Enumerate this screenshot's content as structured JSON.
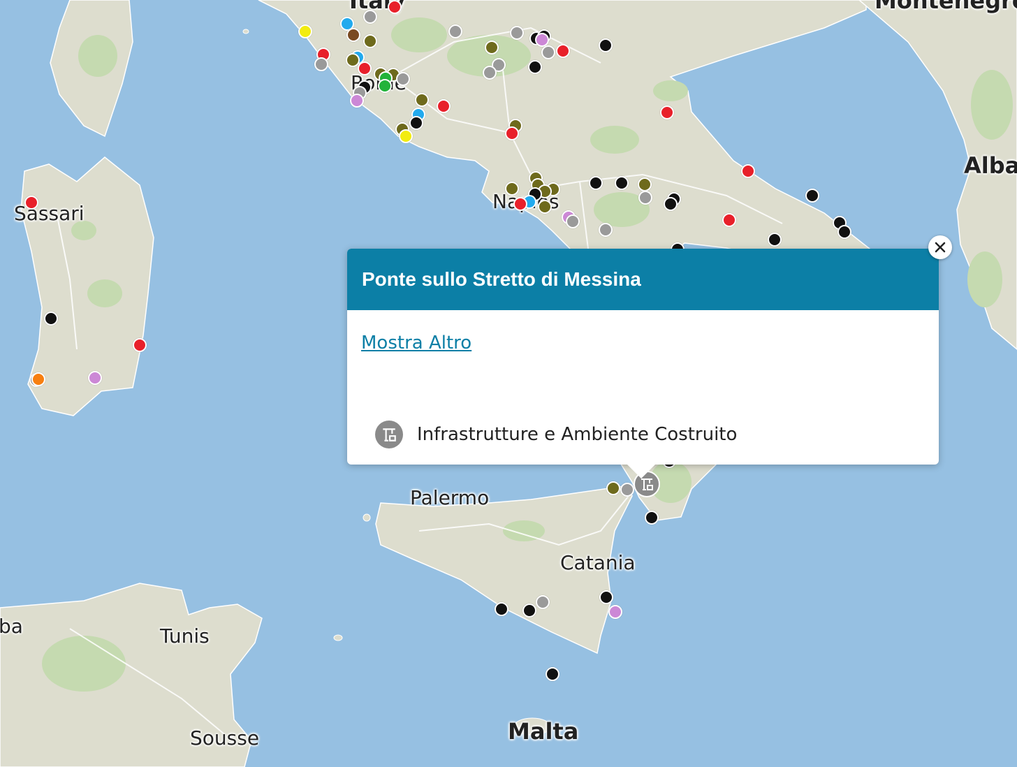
{
  "map": {
    "place_labels": {
      "italy": "Italy",
      "rome": "Rome",
      "naples": "Naples",
      "sassari": "Sassari",
      "palermo": "Palermo",
      "catania": "Catania",
      "tunis": "Tunis",
      "sousse": "Sousse",
      "malta": "Malta",
      "albania": "Alba",
      "montenegro": "Montenegro",
      "algeria_partial": "ba"
    },
    "marker_colors": {
      "black": "#111111",
      "red": "#e8202a",
      "grey": "#9a9a9a",
      "olive": "#6e6a1c",
      "yellow": "#f2ec10",
      "cyan": "#22aaee",
      "green": "#22b33a",
      "brown": "#7a4a22",
      "violet": "#cc88d6",
      "orange": "#f77f10"
    },
    "colors": {
      "sea": "#96c0e2",
      "land": "#ddddce",
      "forest": "#c5dab0",
      "popup_header": "#0c7fa6"
    }
  },
  "popup": {
    "title": "Ponte sullo Stretto di Messina",
    "link": "Mostra Altro",
    "category": "Infrastrutture e Ambiente Costruito",
    "category_icon": "construction-crane-icon",
    "close_icon": "close-icon"
  }
}
